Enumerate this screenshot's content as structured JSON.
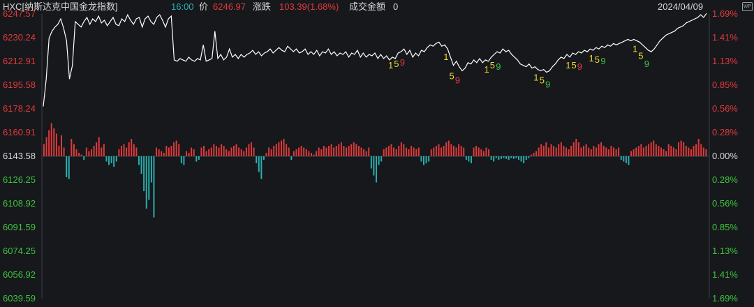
{
  "header": {
    "symbol": "HXC[纳斯达克中国金龙指数]",
    "time": "16:00",
    "price_label": "价",
    "price": "6246.97",
    "change_label": "涨跌",
    "change": "103.39(1.68%)",
    "volume_label": "成交金额",
    "volume": "0",
    "date": "2024/04/09",
    "icon_text": "WP"
  },
  "colors": {
    "background": "#16181c",
    "up": "#e23a3a",
    "down": "#2ab0b0",
    "neutral": "#d8d8d8",
    "line": "#ffffff",
    "grid": "#2b2f35",
    "label_1": "#f0dc32",
    "label_5": "#f0dc32",
    "label_9_red": "#e23a3a",
    "label_9_green": "#3ec43e"
  },
  "chart_data": {
    "type": "line",
    "subtype": "intraday-index-with-bars",
    "left_axis_labels": [
      "6247.57",
      "6230.24",
      "6212.91",
      "6195.58",
      "6178.24",
      "6160.91",
      "6143.58",
      "6126.25",
      "6108.92",
      "6091.59",
      "6074.25",
      "6056.92",
      "6039.59"
    ],
    "right_axis_labels": [
      "1.69%",
      "1.41%",
      "1.13%",
      "0.85%",
      "0.56%",
      "0.28%",
      "0.00%",
      "0.28%",
      "0.56%",
      "0.85%",
      "1.13%",
      "1.41%",
      "1.69%"
    ],
    "ylim": [
      6039.59,
      6247.57
    ],
    "baseline": 6143.58,
    "series": [
      {
        "y": [
          6180,
          6200,
          6230,
          6235,
          6238,
          6240,
          6244,
          6237,
          6228,
          6200,
          6210,
          6242,
          6240,
          6238,
          6242,
          6245,
          6240,
          6244,
          6242,
          6246,
          6241,
          6243,
          6239,
          6242,
          6245,
          6240,
          6239,
          6244,
          6242,
          6247,
          6243,
          6240,
          6244,
          6245,
          6238,
          6244,
          6246,
          6242,
          6240,
          6245,
          6247,
          6243,
          6238,
          6244,
          6246,
          6214,
          6213,
          6215,
          6214,
          6213,
          6216,
          6214,
          6213,
          6215,
          6214,
          6225,
          6213,
          6214,
          6215,
          6235,
          6215,
          6218,
          6214,
          6216,
          6222,
          6216,
          6218,
          6215,
          6218,
          6216,
          6218,
          6219,
          6221,
          6218,
          6220,
          6217,
          6219,
          6220,
          6222,
          6219,
          6221,
          6223,
          6221,
          6220,
          6224,
          6222,
          6220,
          6222,
          6219,
          6220,
          6222,
          6218,
          6220,
          6218,
          6221,
          6217,
          6220,
          6219,
          6222,
          6218,
          6220,
          6217,
          6219,
          6218,
          6220,
          6216,
          6219,
          6218,
          6221,
          6216,
          6219,
          6216,
          6218,
          6217,
          6219,
          6215,
          6218,
          6215,
          6217,
          6214,
          6216,
          6215,
          6219,
          6220,
          6222,
          6218,
          6221,
          6216,
          6219,
          6217,
          6221,
          6220,
          6223,
          6225,
          6224,
          6226,
          6227,
          6224,
          6225,
          6222,
          6216,
          6210,
          6213,
          6209,
          6206,
          6208,
          6212,
          6211,
          6214,
          6212,
          6215,
          6212,
          6214,
          6213,
          6216,
          6218,
          6220,
          6219,
          6222,
          6220,
          6221,
          6218,
          6216,
          6214,
          6211,
          6210,
          6209,
          6211,
          6208,
          6209,
          6207,
          6206,
          6207,
          6205,
          6206,
          6209,
          6211,
          6214,
          6216,
          6215,
          6218,
          6216,
          6219,
          6218,
          6220,
          6219,
          6221,
          6220,
          6222,
          6221,
          6223,
          6222,
          6224,
          6223,
          6225,
          6224,
          6226,
          6225,
          6226,
          6227,
          6228,
          6229,
          6228,
          6229,
          6228,
          6227,
          6225,
          6223,
          6221,
          6220,
          6222,
          6225,
          6228,
          6230,
          6232,
          6233,
          6234,
          6235,
          6237,
          6238,
          6239,
          6241,
          6242,
          6243,
          6244,
          6245,
          6247,
          6245,
          6248
        ]
      }
    ],
    "volume": [
      14,
      22,
      30,
      38,
      32,
      26,
      12,
      24,
      10,
      -24,
      -26,
      20,
      14,
      8,
      4,
      2,
      -4,
      10,
      6,
      8,
      12,
      16,
      22,
      10,
      14,
      -6,
      -10,
      -8,
      -12,
      -6,
      8,
      12,
      14,
      10,
      16,
      20,
      14,
      10,
      -10,
      -20,
      -40,
      -60,
      -50,
      -30,
      -70,
      10,
      8,
      6,
      4,
      12,
      10,
      12,
      16,
      18,
      14,
      -8,
      -10,
      6,
      4,
      10,
      8,
      -6,
      -4,
      10,
      12,
      6,
      8,
      10,
      14,
      12,
      10,
      14,
      12,
      8,
      6,
      10,
      12,
      14,
      10,
      8,
      6,
      10,
      14,
      16,
      10,
      -8,
      -18,
      -26,
      -4,
      4,
      10,
      8,
      12,
      14,
      16,
      18,
      20,
      14,
      10,
      -4,
      6,
      8,
      10,
      12,
      10,
      8,
      6,
      4,
      2,
      6,
      10,
      8,
      12,
      10,
      12,
      14,
      10,
      12,
      14,
      16,
      12,
      10,
      12,
      14,
      16,
      14,
      12,
      10,
      8,
      6,
      10,
      -14,
      -22,
      -30,
      -10,
      -6,
      8,
      10,
      12,
      14,
      10,
      8,
      12,
      16,
      14,
      10,
      8,
      12,
      10,
      8,
      10,
      -6,
      -10,
      -8,
      -6,
      8,
      10,
      12,
      14,
      10,
      12,
      16,
      18,
      14,
      12,
      10,
      14,
      12,
      10,
      -4,
      -6,
      -8,
      10,
      12,
      10,
      8,
      6,
      10,
      8,
      -4,
      -6,
      -2,
      -4,
      -3,
      -2,
      -3,
      -4,
      -2,
      -3,
      -2,
      -4,
      -6,
      -8,
      -4,
      -2,
      2,
      4,
      6,
      10,
      14,
      12,
      16,
      10,
      14,
      12,
      10,
      14,
      16,
      12,
      10,
      8,
      12,
      16,
      20,
      16,
      10,
      12,
      14,
      10,
      8,
      12,
      10,
      14,
      16,
      12,
      10,
      8,
      12,
      10,
      8,
      10,
      -4,
      -6,
      -8,
      -10,
      6,
      8,
      10,
      12,
      14,
      10,
      12,
      14,
      16,
      18,
      14,
      12,
      10,
      8,
      6,
      14,
      12,
      10,
      8,
      16,
      18,
      16,
      12,
      10,
      8,
      12,
      14,
      20,
      14,
      10,
      8
    ],
    "annotations": [
      {
        "text": "1",
        "index": 120,
        "color": "label_1"
      },
      {
        "text": "5",
        "index": 122,
        "color": "label_5"
      },
      {
        "text": "9",
        "index": 124,
        "color": "label_9_red"
      },
      {
        "text": "1",
        "index": 139,
        "color": "label_1"
      },
      {
        "text": "5",
        "index": 141,
        "color": "label_5"
      },
      {
        "text": "9",
        "index": 143,
        "color": "label_9_red"
      },
      {
        "text": "1",
        "index": 153,
        "color": "label_1"
      },
      {
        "text": "5",
        "index": 155,
        "color": "label_5"
      },
      {
        "text": "9",
        "index": 157,
        "color": "label_9_green"
      },
      {
        "text": "1",
        "index": 170,
        "color": "label_1"
      },
      {
        "text": "5",
        "index": 172,
        "color": "label_5"
      },
      {
        "text": "9",
        "index": 174,
        "color": "label_9_green"
      },
      {
        "text": "1",
        "index": 181,
        "color": "label_1"
      },
      {
        "text": "5",
        "index": 183,
        "color": "label_5"
      },
      {
        "text": "9",
        "index": 185,
        "color": "label_9_red"
      },
      {
        "text": "1",
        "index": 189,
        "color": "label_1"
      },
      {
        "text": "5",
        "index": 191,
        "color": "label_5"
      },
      {
        "text": "9",
        "index": 193,
        "color": "label_9_green"
      },
      {
        "text": "1",
        "index": 204,
        "color": "label_1"
      },
      {
        "text": "5",
        "index": 206,
        "color": "label_5"
      },
      {
        "text": "9",
        "index": 208,
        "color": "label_9_green"
      }
    ],
    "grid": false
  }
}
